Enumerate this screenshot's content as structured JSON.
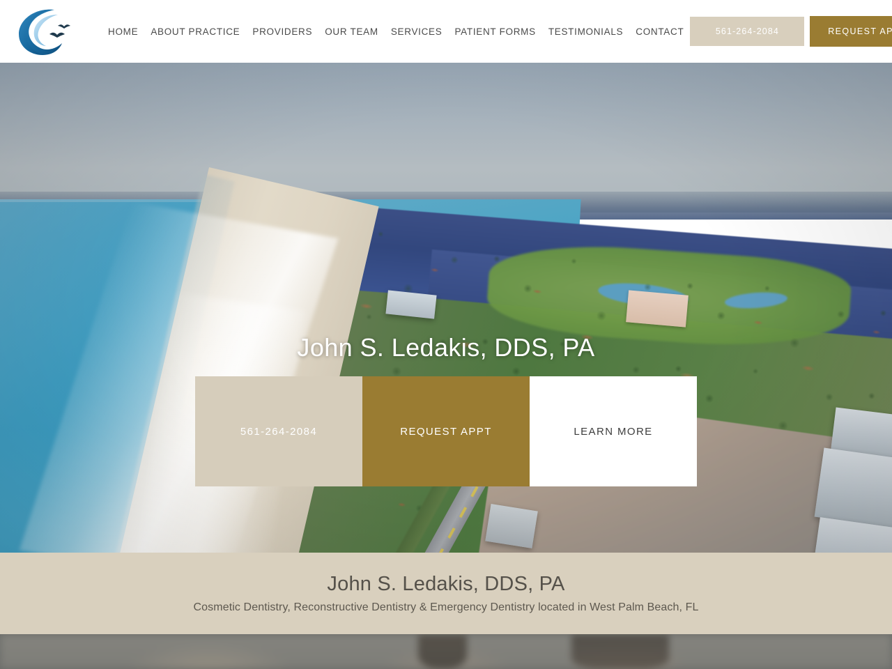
{
  "header": {
    "logo": {
      "icon": "wave-birds-logo",
      "alt": "John S. Ledakis DDS PA logo",
      "colors": {
        "outer": "#1d6ea8",
        "inner": "#8dc5e8",
        "birds": "#223a4d"
      }
    },
    "nav": [
      {
        "label": "HOME",
        "name": "nav-item-home"
      },
      {
        "label": "ABOUT PRACTICE",
        "name": "nav-item-about-practice"
      },
      {
        "label": "PROVIDERS",
        "name": "nav-item-providers"
      },
      {
        "label": "OUR TEAM",
        "name": "nav-item-our-team"
      },
      {
        "label": "SERVICES",
        "name": "nav-item-services"
      },
      {
        "label": "PATIENT FORMS",
        "name": "nav-item-patient-forms"
      },
      {
        "label": "TESTIMONIALS",
        "name": "nav-item-testimonials"
      },
      {
        "label": "CONTACT",
        "name": "nav-item-contact"
      }
    ],
    "phone_button": {
      "label": "561-264-2084",
      "bg": "#d8cfbd",
      "fg": "#ffffff"
    },
    "appt_button": {
      "label": "REQUEST APPT",
      "bg": "#9a7c32",
      "fg": "#ffffff"
    }
  },
  "hero": {
    "title": "John S. Ledakis, DDS, PA",
    "background_alt": "Aerial view of West Palm Beach coastline with ocean, beach, golf course and intracoastal waterway",
    "ctas": [
      {
        "label": "561-264-2084",
        "name": "hero-cta-phone",
        "bg": "#d6cdbb",
        "fg": "#ffffff"
      },
      {
        "label": "REQUEST APPT",
        "name": "hero-cta-request-appt",
        "bg": "#9a7c32",
        "fg": "#ffffff"
      },
      {
        "label": "LEARN MORE",
        "name": "hero-cta-learn-more",
        "bg": "#ffffff",
        "fg": "#3d3d3d"
      }
    ]
  },
  "info_band": {
    "title": "John S. Ledakis, DDS, PA",
    "subtitle": "Cosmetic Dentistry, Reconstructive Dentistry & Emergency Dentistry located in West Palm Beach, FL",
    "bg": "#d9d0be"
  },
  "next_section": {
    "alt": "Partially visible photograph of patients below the fold"
  }
}
